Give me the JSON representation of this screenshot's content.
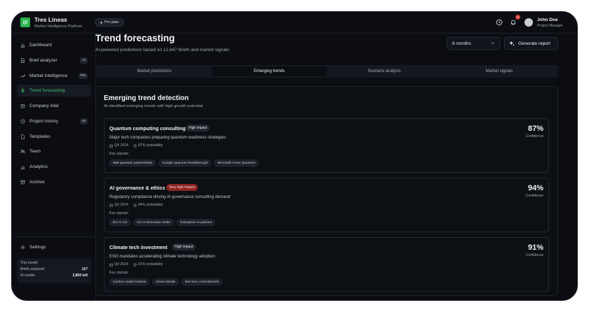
{
  "brand": {
    "name": "Tres Líneas",
    "subtitle": "Market Intelligence Platform",
    "logo_glyph": "///",
    "plan": "Pro plan"
  },
  "header": {
    "notification_count": "3",
    "user_name": "John Doe",
    "user_role": "Project Manager"
  },
  "sidebar": {
    "items": [
      {
        "label": "Dashboard",
        "icon": "bar-chart-icon",
        "tag": ""
      },
      {
        "label": "Brief analyzer",
        "icon": "document-icon",
        "tag": "AI"
      },
      {
        "label": "Market intelligence",
        "icon": "trending-up-icon",
        "tag": "Pro"
      },
      {
        "label": "Trend forecasting",
        "icon": "zap-icon",
        "tag": ""
      },
      {
        "label": "Company intel",
        "icon": "building-icon",
        "tag": ""
      },
      {
        "label": "Project history",
        "icon": "clock-icon",
        "tag": "24"
      },
      {
        "label": "Templates",
        "icon": "file-icon",
        "tag": ""
      },
      {
        "label": "Team",
        "icon": "users-icon",
        "tag": ""
      },
      {
        "label": "Analytics",
        "icon": "analytics-icon",
        "tag": ""
      },
      {
        "label": "Archive",
        "icon": "archive-icon",
        "tag": ""
      }
    ],
    "settings_label": "Settings",
    "stats": {
      "title": "This month",
      "briefs_label": "Briefs analyzed",
      "briefs_value": "127",
      "credits_label": "AI credits",
      "credits_value": "2,850 left"
    }
  },
  "main": {
    "title": "Trend forecasting",
    "subtitle": "AI-powered predictions based on 12,847 briefs and market signals",
    "period_select": "6 months",
    "generate_label": "Generate report",
    "tabs": [
      "Market predictions",
      "Emerging trends",
      "Scenario analysis",
      "Market signals"
    ],
    "active_tab": 1,
    "panel_title": "Emerging trend detection",
    "panel_subtitle": "AI-identified emerging trends with high growth potential",
    "key_signals_label": "Key signals:",
    "confidence_label": "Confidence",
    "trends": [
      {
        "title": "Quantum computing consulting",
        "impact": "High impact",
        "description": "Major tech companies preparing quantum readiness strategies",
        "quarter": "Q4 2024",
        "probability": "87% probability",
        "confidence": "87%",
        "signals": [
          "IBM quantum partnerships",
          "Google quantum breakthrough",
          "Microsoft Azure Quantum"
        ]
      },
      {
        "title": "AI governance & ethics",
        "impact": "Very high impact",
        "description": "Regulatory compliance driving AI governance consulting demand",
        "quarter": "Q3 2024",
        "probability": "94% probability",
        "confidence": "94%",
        "signals": [
          "EU AI Act",
          "US AI Executive Order",
          "Enterprise AI policies"
        ]
      },
      {
        "title": "Climate tech investment",
        "impact": "High impact",
        "description": "ESG mandates accelerating climate technology adoption",
        "quarter": "Q4 2024",
        "probability": "91% probability",
        "confidence": "91%",
        "signals": [
          "Carbon credit markets",
          "Green bonds",
          "Net-zero commitments"
        ]
      }
    ]
  },
  "colors": {
    "accent": "#3fc26a",
    "logo": "#29b34f",
    "danger": "#8a2424",
    "background": "#0b0d12"
  }
}
